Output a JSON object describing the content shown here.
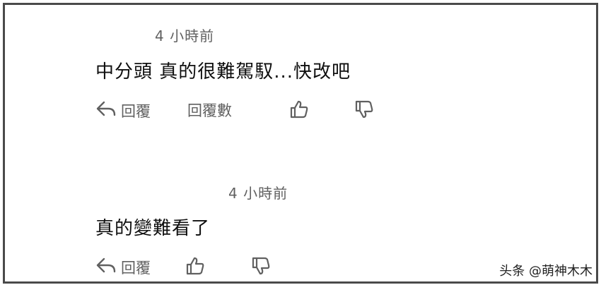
{
  "comments": [
    {
      "time": "4 小時前",
      "text": "中分頭 真的很難駕馭...快改吧",
      "reply_label": "回覆",
      "replies_label": "回覆數",
      "icons": [
        "reply-icon",
        "thumbs-up-icon",
        "thumbs-down-icon"
      ]
    },
    {
      "time": "4 小時前",
      "text": "真的變難看了",
      "reply_label": "回覆",
      "icons": [
        "reply-icon",
        "thumbs-up-icon",
        "thumbs-down-icon"
      ]
    }
  ],
  "watermark": "头条 @萌神木木",
  "colors": {
    "text": "#0f0f0f",
    "secondary": "#606060",
    "border": "#4a4a4a"
  }
}
